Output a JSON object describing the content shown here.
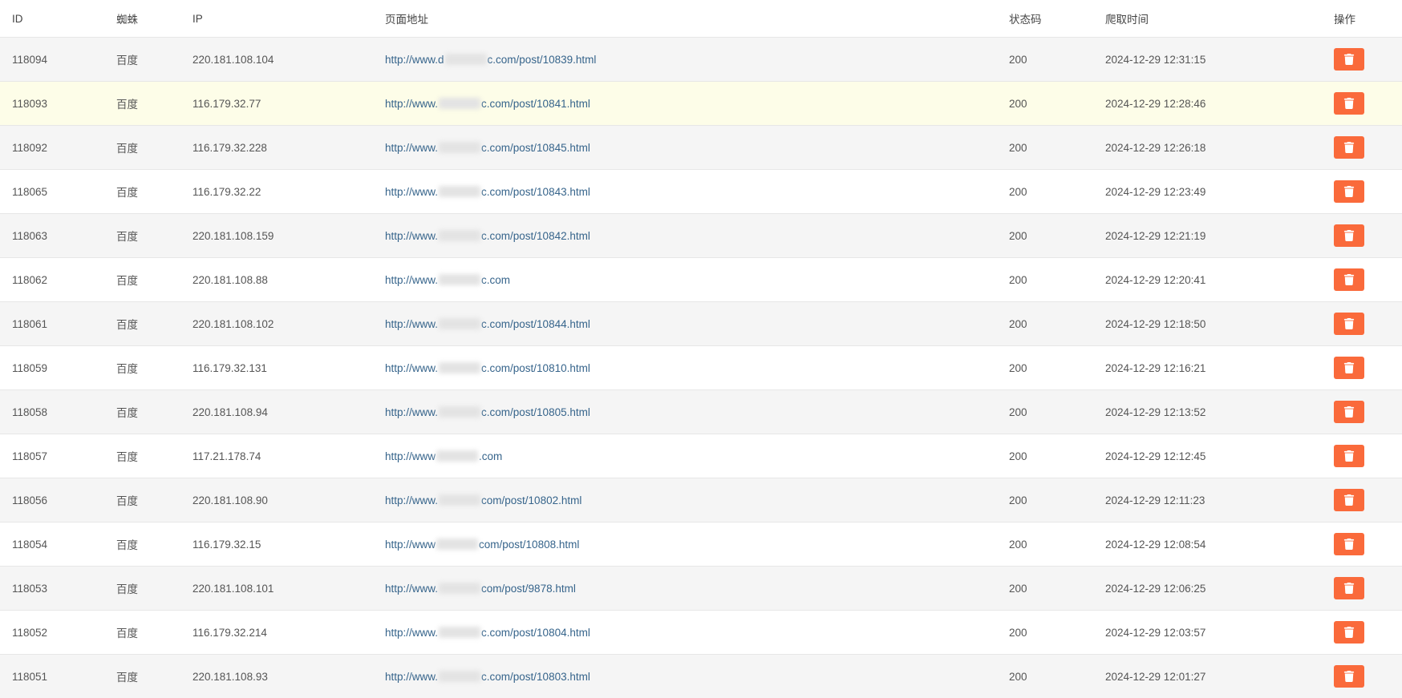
{
  "columns": {
    "id": "ID",
    "spider": "蜘蛛",
    "ip": "IP",
    "url": "页面地址",
    "status": "状态码",
    "crawl_time": "爬取时间",
    "operation": "操作"
  },
  "rows": [
    {
      "id": "118094",
      "spider": "百度",
      "ip": "220.181.108.104",
      "url_prefix": "http://www.d",
      "url_suffix": "c.com/post/10839.html",
      "status": "200",
      "time": "2024-12-29 12:31:15",
      "highlight": false
    },
    {
      "id": "118093",
      "spider": "百度",
      "ip": "116.179.32.77",
      "url_prefix": "http://www.",
      "url_suffix": "c.com/post/10841.html",
      "status": "200",
      "time": "2024-12-29 12:28:46",
      "highlight": true
    },
    {
      "id": "118092",
      "spider": "百度",
      "ip": "116.179.32.228",
      "url_prefix": "http://www.",
      "url_suffix": "c.com/post/10845.html",
      "status": "200",
      "time": "2024-12-29 12:26:18",
      "highlight": false
    },
    {
      "id": "118065",
      "spider": "百度",
      "ip": "116.179.32.22",
      "url_prefix": "http://www.",
      "url_suffix": "c.com/post/10843.html",
      "status": "200",
      "time": "2024-12-29 12:23:49",
      "highlight": false
    },
    {
      "id": "118063",
      "spider": "百度",
      "ip": "220.181.108.159",
      "url_prefix": "http://www.",
      "url_suffix": "c.com/post/10842.html",
      "status": "200",
      "time": "2024-12-29 12:21:19",
      "highlight": false
    },
    {
      "id": "118062",
      "spider": "百度",
      "ip": "220.181.108.88",
      "url_prefix": "http://www.",
      "url_suffix": "c.com",
      "status": "200",
      "time": "2024-12-29 12:20:41",
      "highlight": false
    },
    {
      "id": "118061",
      "spider": "百度",
      "ip": "220.181.108.102",
      "url_prefix": "http://www.",
      "url_suffix": "c.com/post/10844.html",
      "status": "200",
      "time": "2024-12-29 12:18:50",
      "highlight": false
    },
    {
      "id": "118059",
      "spider": "百度",
      "ip": "116.179.32.131",
      "url_prefix": "http://www.",
      "url_suffix": "c.com/post/10810.html",
      "status": "200",
      "time": "2024-12-29 12:16:21",
      "highlight": false
    },
    {
      "id": "118058",
      "spider": "百度",
      "ip": "220.181.108.94",
      "url_prefix": "http://www.",
      "url_suffix": "c.com/post/10805.html",
      "status": "200",
      "time": "2024-12-29 12:13:52",
      "highlight": false
    },
    {
      "id": "118057",
      "spider": "百度",
      "ip": "117.21.178.74",
      "url_prefix": "http://www",
      "url_suffix": ".com",
      "status": "200",
      "time": "2024-12-29 12:12:45",
      "highlight": false
    },
    {
      "id": "118056",
      "spider": "百度",
      "ip": "220.181.108.90",
      "url_prefix": "http://www.",
      "url_suffix": "com/post/10802.html",
      "status": "200",
      "time": "2024-12-29 12:11:23",
      "highlight": false
    },
    {
      "id": "118054",
      "spider": "百度",
      "ip": "116.179.32.15",
      "url_prefix": "http://www",
      "url_suffix": "com/post/10808.html",
      "status": "200",
      "time": "2024-12-29 12:08:54",
      "highlight": false
    },
    {
      "id": "118053",
      "spider": "百度",
      "ip": "220.181.108.101",
      "url_prefix": "http://www.",
      "url_suffix": "com/post/9878.html",
      "status": "200",
      "time": "2024-12-29 12:06:25",
      "highlight": false
    },
    {
      "id": "118052",
      "spider": "百度",
      "ip": "116.179.32.214",
      "url_prefix": "http://www.",
      "url_suffix": "c.com/post/10804.html",
      "status": "200",
      "time": "2024-12-29 12:03:57",
      "highlight": false
    },
    {
      "id": "118051",
      "spider": "百度",
      "ip": "220.181.108.93",
      "url_prefix": "http://www.",
      "url_suffix": "c.com/post/10803.html",
      "status": "200",
      "time": "2024-12-29 12:01:27",
      "highlight": false
    }
  ],
  "icons": {
    "trash": "trash-icon"
  }
}
